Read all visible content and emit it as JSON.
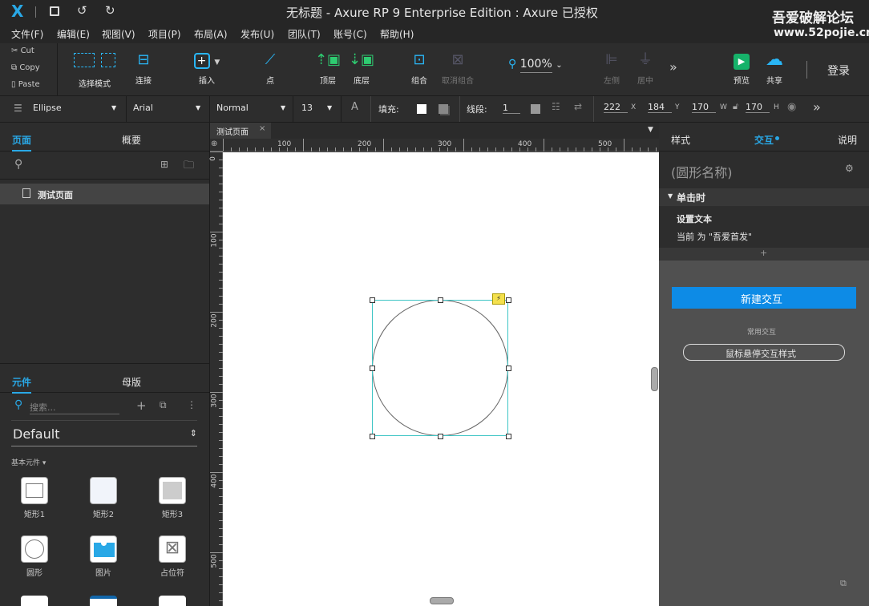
{
  "titlebar": {
    "title": "无标题 - Axure RP 9 Enterprise Edition : Axure 已授权",
    "watermark_line1": "吾爱破解论坛",
    "watermark_line2": "www.52pojie.cn",
    "logo": "X"
  },
  "menu": [
    "文件(F)",
    "编辑(E)",
    "视图(V)",
    "项目(P)",
    "布局(A)",
    "发布(U)",
    "团队(T)",
    "账号(C)",
    "帮助(H)"
  ],
  "clipboard": {
    "cut": "Cut",
    "copy": "Copy",
    "paste": "Paste"
  },
  "toolbar": {
    "select_mode": "选择模式",
    "connect": "连接",
    "insert": "插入",
    "point": "点",
    "top": "顶层",
    "bottom": "底层",
    "group": "组合",
    "ungroup": "取消组合",
    "zoom": "100%",
    "left": "左侧",
    "center": "居中",
    "preview": "预览",
    "share": "共享",
    "login": "登录"
  },
  "propbar": {
    "shape": "Ellipse",
    "font": "Arial",
    "style": "Normal",
    "size": "13",
    "font_color_glyph": "A",
    "fill_label": "填充:",
    "line_label": "线段:",
    "line_width": "1",
    "x": "222",
    "x_label": "X",
    "y": "184",
    "y_label": "Y",
    "w": "170",
    "w_label": "W",
    "h": "170",
    "h_label": "H"
  },
  "left": {
    "tab_pages": "页面",
    "tab_outline": "概要",
    "page_item": "测试页面",
    "tab_widgets": "元件",
    "tab_masters": "母版",
    "search_placeholder": "搜索...",
    "library": "Default",
    "category": "基本元件 ▾",
    "widgets": [
      "矩形1",
      "矩形2",
      "矩形3",
      "圆形",
      "图片",
      "占位符"
    ]
  },
  "canvas": {
    "doc_tab": "测试页面",
    "ruler_h": [
      "100",
      "200",
      "300",
      "400",
      "500"
    ],
    "ruler_v": [
      "0",
      "100",
      "200",
      "300",
      "400",
      "500"
    ]
  },
  "right": {
    "tab_style": "样式",
    "tab_interactions": "交互",
    "tab_notes": "说明",
    "shape_name": "(圆形名称)",
    "event": "单击时",
    "action": "设置文本",
    "action_detail": "当前 为 \"吾爱首发\"",
    "add_plus": "+",
    "new_interaction": "新建交互",
    "common_label": "常用交互",
    "hover_style": "鼠标悬停交互样式"
  },
  "colors": {
    "accent": "#0d8be6",
    "selection": "#3ec5c5",
    "canvas": "#ffffff",
    "preview_green": "#16b26a"
  }
}
